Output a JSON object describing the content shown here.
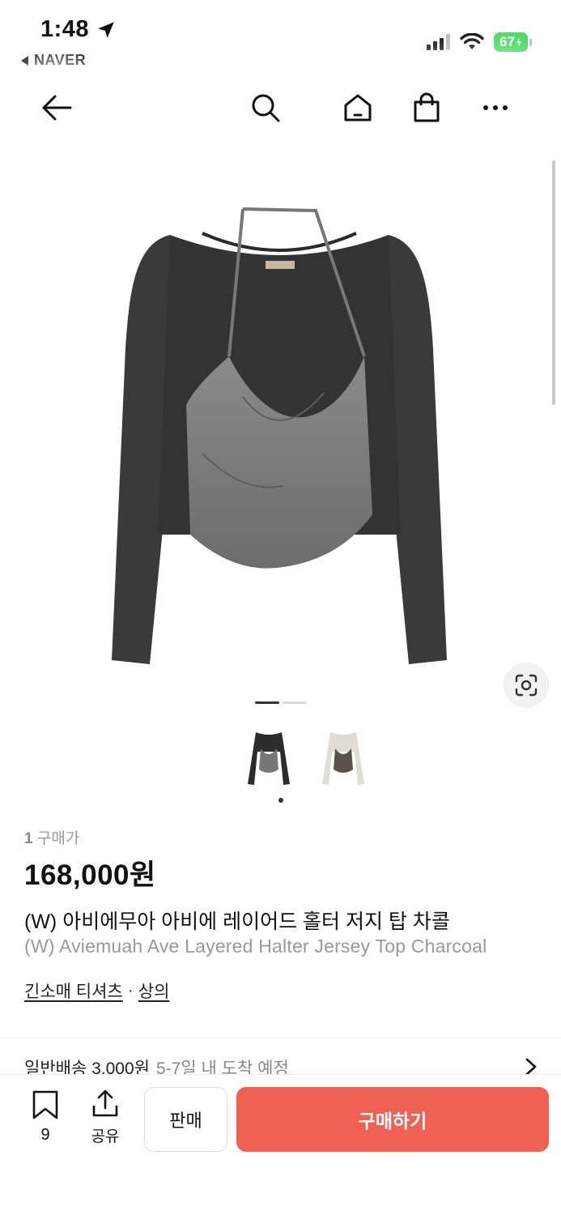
{
  "status_bar": {
    "time": "1:48",
    "back_app": "NAVER",
    "battery": "67"
  },
  "nav": {
    "icons": [
      "back-arrow-icon",
      "search-icon",
      "home-icon",
      "shopping-bag-icon",
      "more-icon"
    ]
  },
  "gallery": {
    "page_count": 2,
    "current_page": 1,
    "thumbnails": [
      "charcoal",
      "cream"
    ]
  },
  "product": {
    "purchase_count": "1",
    "purchase_label": "구매가",
    "price": "168,000원",
    "title_ko": "(W) 아비에무아 아비에 레이어드 홀터 저지 탑 차콜",
    "title_en": "(W) Aviemuah Ave Layered Halter Jersey Top Charcoal",
    "category": "긴소매 티셔츠",
    "category_sep": "·",
    "parent_category": "상의"
  },
  "shipping": {
    "label": "일반배송 3,000원",
    "eta": "5-7일 내 도착 예정"
  },
  "bottom_bar": {
    "bookmark_count": "9",
    "share_label": "공유",
    "sell_label": "판매",
    "buy_label": "구매하기"
  },
  "colors": {
    "buy_button": "#ef6253",
    "battery": "#4cd964"
  }
}
